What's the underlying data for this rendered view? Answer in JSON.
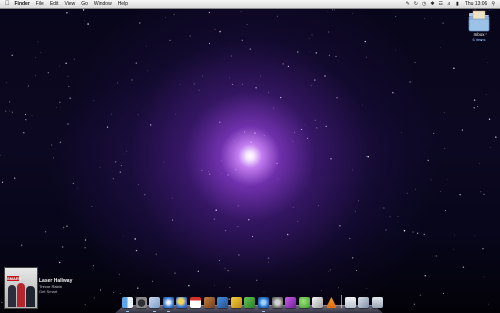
{
  "menubar": {
    "apple_icon": "apple-logo-icon",
    "app_name": "Finder",
    "items": [
      "File",
      "Edit",
      "View",
      "Go",
      "Window",
      "Help"
    ],
    "extras_icons": [
      "script-icon",
      "sync-icon",
      "time-machine-icon",
      "bluetooth-icon",
      "wifi-icon",
      "volume-icon",
      "battery-icon"
    ],
    "clock": "Thu 13:06",
    "spotlight_icon": "spotlight-search-icon"
  },
  "desktop_icons": [
    {
      "name": "Inbox",
      "subtitle": "6 items",
      "icon": "folder-icon"
    }
  ],
  "now_playing": {
    "track": "Laser Hallway",
    "artist": "Trevor Rabin",
    "album": "Get Smart",
    "art_banner": "SMART"
  },
  "dock": {
    "apps": [
      {
        "name": "Finder",
        "icon": "finder-icon",
        "running": true
      },
      {
        "name": "Dashboard",
        "icon": "dashboard-icon",
        "running": false
      },
      {
        "name": "Mail",
        "icon": "mail-icon",
        "running": true
      },
      {
        "name": "Safari",
        "icon": "safari-icon",
        "running": true
      },
      {
        "name": "iChat",
        "icon": "ichat-icon",
        "running": false
      },
      {
        "name": "iCal",
        "icon": "ical-icon",
        "running": false
      },
      {
        "name": "Photo Booth",
        "icon": "photo-icon",
        "running": false
      },
      {
        "name": "Pen",
        "icon": "pen-icon",
        "running": false
      },
      {
        "name": "Game",
        "icon": "game-icon",
        "running": false
      },
      {
        "name": "Green App",
        "icon": "green-app-icon",
        "running": false
      },
      {
        "name": "iTunes",
        "icon": "itunes-icon",
        "running": true
      },
      {
        "name": "System Preferences",
        "icon": "system-preferences-icon",
        "running": false
      },
      {
        "name": "Purple App",
        "icon": "purple-app-icon",
        "running": false
      },
      {
        "name": "Leaf App",
        "icon": "leaf-icon",
        "running": false
      },
      {
        "name": "Sign App",
        "icon": "sign-icon",
        "running": false
      },
      {
        "name": "VLC",
        "icon": "vlc-icon",
        "running": false
      }
    ],
    "stacks": [
      {
        "name": "Documents",
        "icon": "documents-stack-icon"
      },
      {
        "name": "Downloads",
        "icon": "downloads-stack-icon"
      },
      {
        "name": "Trash",
        "icon": "trash-icon"
      }
    ]
  },
  "colors": {
    "menubar_bg": "#e6e6e6",
    "desktop_bg": "#07061a",
    "nebula": "#9b4fd6"
  }
}
